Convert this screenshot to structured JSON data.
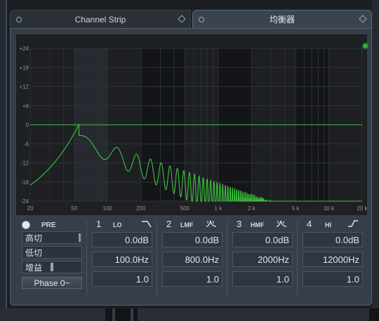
{
  "tabs": [
    {
      "label": "Channel Strip",
      "active": false
    },
    {
      "label": "均衡器",
      "active": true
    }
  ],
  "graph": {
    "y_labels": [
      "+24",
      "+18",
      "+12",
      "+6",
      "0",
      "-6",
      "-12",
      "-18",
      "-24"
    ],
    "x_labels": [
      "20",
      "50",
      "100",
      "200",
      "500",
      "1 k",
      "2 k",
      "5 k",
      "10 k",
      "20 k"
    ],
    "curve_color": "#3ec43e"
  },
  "left": {
    "pre_label": "PRE",
    "high_cut_label": "高切",
    "low_cut_label": "低切",
    "gain_label": "增益",
    "phase_label": "Phase 0~"
  },
  "bands": [
    {
      "number": "1",
      "name": "LO",
      "icon": "high-pass-filter-icon",
      "gain": "0.0dB",
      "freq": "100.0Hz",
      "q": "1.0"
    },
    {
      "number": "2",
      "name": "LMF",
      "icon": "peak-filter-icon",
      "gain": "0.0dB",
      "freq": "800.0Hz",
      "q": "1.0"
    },
    {
      "number": "3",
      "name": "HMF",
      "icon": "peak-filter-icon",
      "gain": "0.0dB",
      "freq": "2000Hz",
      "q": "1.0"
    },
    {
      "number": "4",
      "name": "HI",
      "icon": "high-shelf-filter-icon",
      "gain": "0.0dB",
      "freq": "12000Hz",
      "q": "1.0"
    }
  ]
}
